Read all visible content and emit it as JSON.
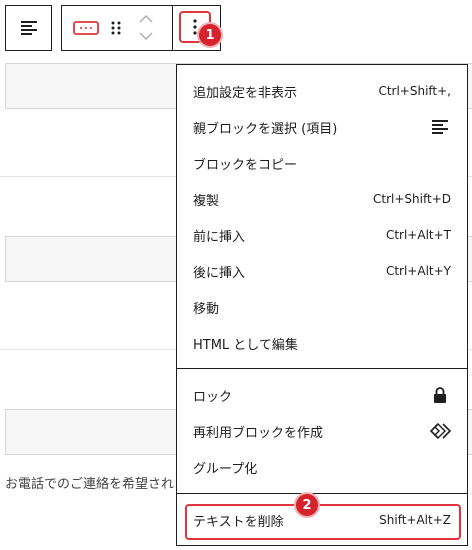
{
  "toolbar": {
    "icons": [
      "align-text-icon",
      "input-field-icon",
      "drag-handle-icon",
      "move-up-icon",
      "move-down-icon",
      "more-options-icon"
    ],
    "badge_1": "1"
  },
  "form": {
    "helper_text": "お電話でのご連絡を希望され"
  },
  "menu": {
    "group1": [
      {
        "label": "追加設定を非表示",
        "shortcut": "Ctrl+Shift+,"
      },
      {
        "label": "親ブロックを選択 (項目)",
        "icon": "parent-block-icon"
      },
      {
        "label": "ブロックをコピー"
      },
      {
        "label": "複製",
        "shortcut": "Ctrl+Shift+D"
      },
      {
        "label": "前に挿入",
        "shortcut": "Ctrl+Alt+T"
      },
      {
        "label": "後に挿入",
        "shortcut": "Ctrl+Alt+Y"
      },
      {
        "label": "移動"
      },
      {
        "label": "HTML として編集"
      }
    ],
    "group2": [
      {
        "label": "ロック",
        "icon": "lock-icon"
      },
      {
        "label": "再利用ブロックを作成",
        "icon": "reusable-block-icon"
      },
      {
        "label": "グループ化"
      }
    ],
    "group3": [
      {
        "label": "テキストを削除",
        "shortcut": "Shift+Alt+Z"
      }
    ],
    "badge_2": "2"
  },
  "colors": {
    "highlight": "#e2343b",
    "badge": "#d6222c",
    "border": "#1e1e1e",
    "field_bg": "#f6f6f7"
  }
}
